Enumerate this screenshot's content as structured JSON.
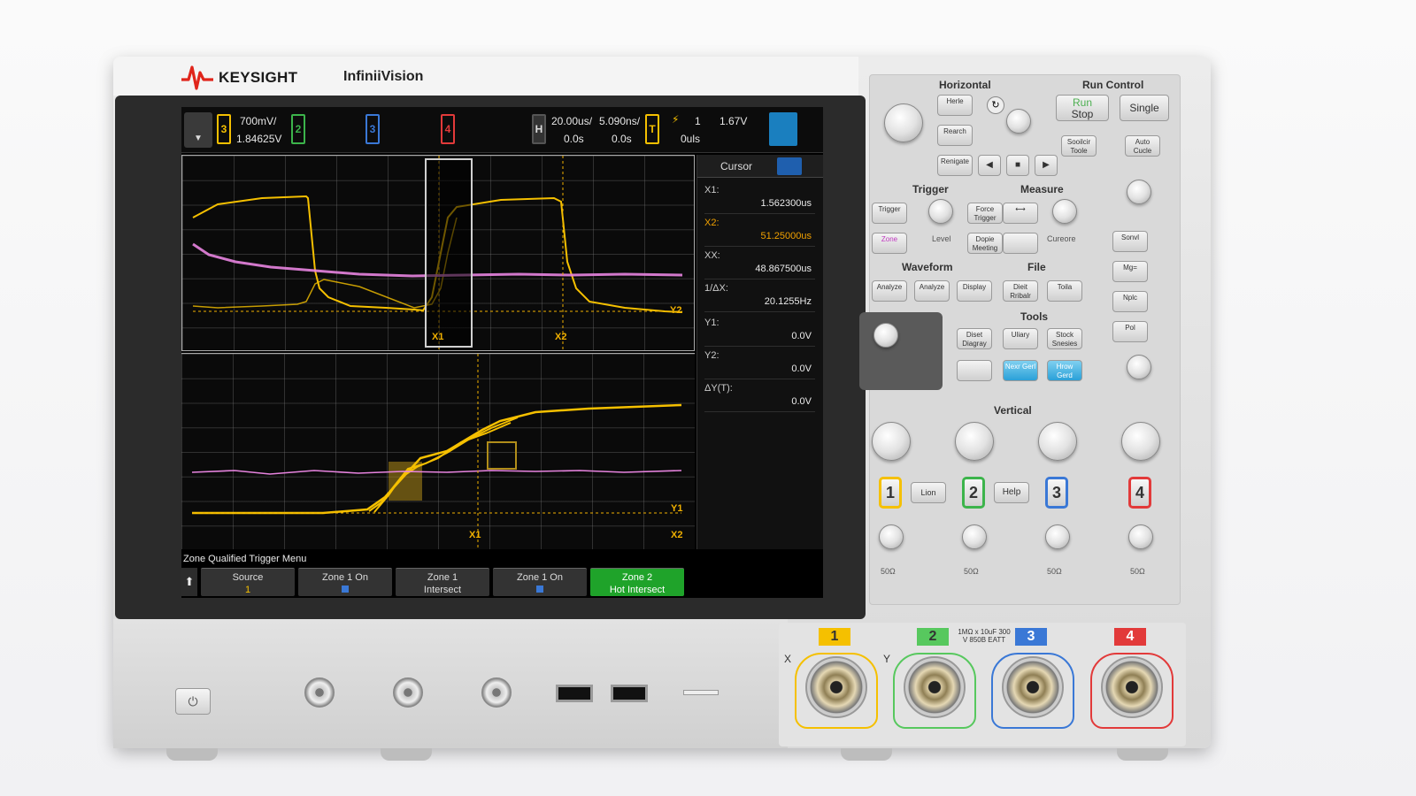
{
  "brand": "KEYSIGHT",
  "model": "InfiniiVision",
  "status": {
    "ch3_scale": "700mV/",
    "ch3_offset": "1.84625V",
    "ch_numbers": [
      "3",
      "2",
      "3",
      "4"
    ],
    "h_label": "H",
    "time_div": "20.00us/",
    "time_ref": "5.090ns/",
    "h_delay": "0.0s",
    "h_pos": "0.0s",
    "t_label": "T",
    "trig_src": "1",
    "trig_level": "1.67V",
    "trig_time": "0uls"
  },
  "markers": {
    "x1": "X1",
    "x2": "X2",
    "y1": "Y1",
    "y2": "Y2"
  },
  "cursor_panel": {
    "title": "Cursor",
    "rows": [
      {
        "label": "X1:",
        "value": "1.562300us"
      },
      {
        "label": "X2:",
        "value": "51.25000us"
      },
      {
        "label": "XX:",
        "value": "48.867500us"
      },
      {
        "label": "1/ΔX:",
        "value": "20.1255Hz"
      },
      {
        "label": "Y1:",
        "value": "0.0V"
      },
      {
        "label": "Y2:",
        "value": "0.0V"
      },
      {
        "label": "ΔY(T):",
        "value": "0.0V"
      }
    ]
  },
  "softmenu": {
    "title": "Zone Qualified Trigger Menu",
    "keys": [
      {
        "line1": "Source",
        "line2": "1"
      },
      {
        "line1": "Zone 1 On",
        "line2": ""
      },
      {
        "line1": "Zone 1",
        "line2": "Intersect"
      },
      {
        "line1": "Zone 1 On",
        "line2": ""
      },
      {
        "line1": "Zone 2",
        "line2": "Hot Intersect"
      }
    ]
  },
  "panel": {
    "horizontal": "Horizontal",
    "run_control": "Run Control",
    "run_stop": "Stop",
    "single": "Single",
    "trigger": "Trigger",
    "measure": "Measure",
    "waveform": "Waveform",
    "file": "File",
    "tools": "Tools",
    "vertical": "Vertical",
    "help": "Help",
    "btn_horiz": [
      "Herle",
      "Rearch",
      "Renigate"
    ],
    "btn_run2": [
      "Sooilcir Toole",
      "Auto Cucle"
    ],
    "btn_trigger": [
      "Trigger",
      "Force Trigger",
      "Zone",
      "Level",
      "Dopie Meeting"
    ],
    "btn_measure": [
      "Cureore"
    ],
    "btn_waveform": [
      "Analyze",
      "Analyze",
      "Display"
    ],
    "btn_file": [
      "Dieit Rribalr",
      "Toila"
    ],
    "btn_tools": [
      "Diset Diagray",
      "Uliary",
      "Stock Snesies",
      "Nexr Gerl",
      "Hrow Gerd"
    ],
    "btn_side": [
      "Sonvl",
      "Mg=",
      "Nplc",
      "Pol"
    ],
    "vertical_ohms": [
      "50Ω",
      "50Ω",
      "50Ω",
      "50Ω"
    ],
    "lbtn": "Lion"
  },
  "front": {
    "ch_labels": [
      "1",
      "2",
      "3",
      "4"
    ],
    "x_label": "X",
    "y_label": "Y",
    "rating": "1MΩ x 10uF 300 V 850B EATT"
  },
  "colors": {
    "ch1": "#f5c000",
    "ch2": "#3cb44b",
    "ch3": "#3a78d6",
    "ch4": "#e23a3a",
    "ch2_trace": "#e884e0",
    "green_key": "#1fa32a"
  }
}
